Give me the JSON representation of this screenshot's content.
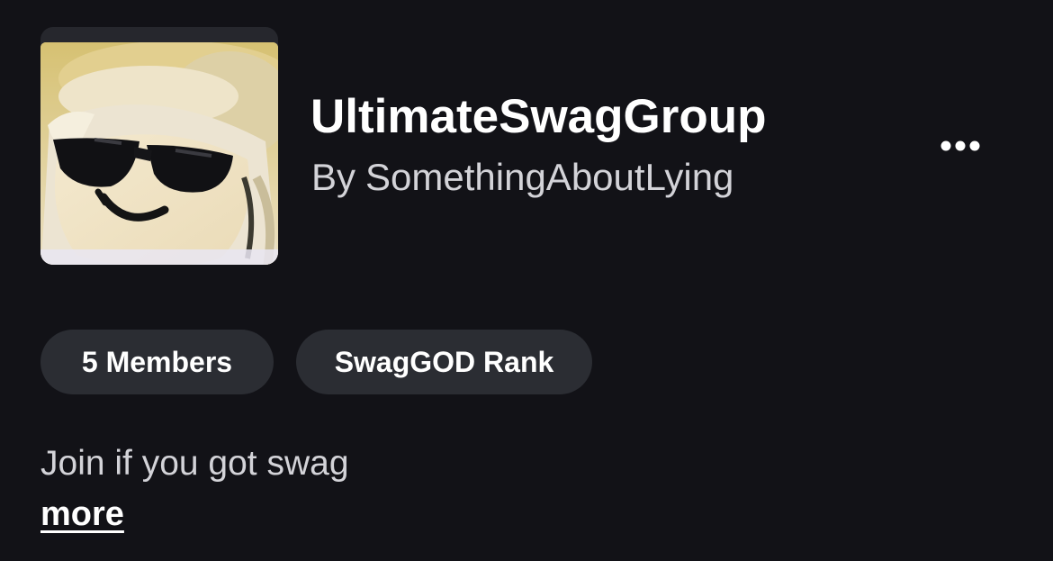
{
  "group": {
    "name": "UltimateSwagGroup",
    "owner_prefix": "By",
    "owner": "SomethingAboutLying",
    "icon": "group-emblem-image"
  },
  "header": {
    "more_options_icon": "ellipsis-icon"
  },
  "chips": {
    "members": "5 Members",
    "rank": "SwagGOD Rank"
  },
  "description": {
    "text": "Join if you got swag",
    "more_label": "more"
  },
  "colors": {
    "background": "#121217",
    "chip_background": "#2b2d33",
    "primary_text": "#ffffff",
    "secondary_text": "#d3d3d8"
  }
}
